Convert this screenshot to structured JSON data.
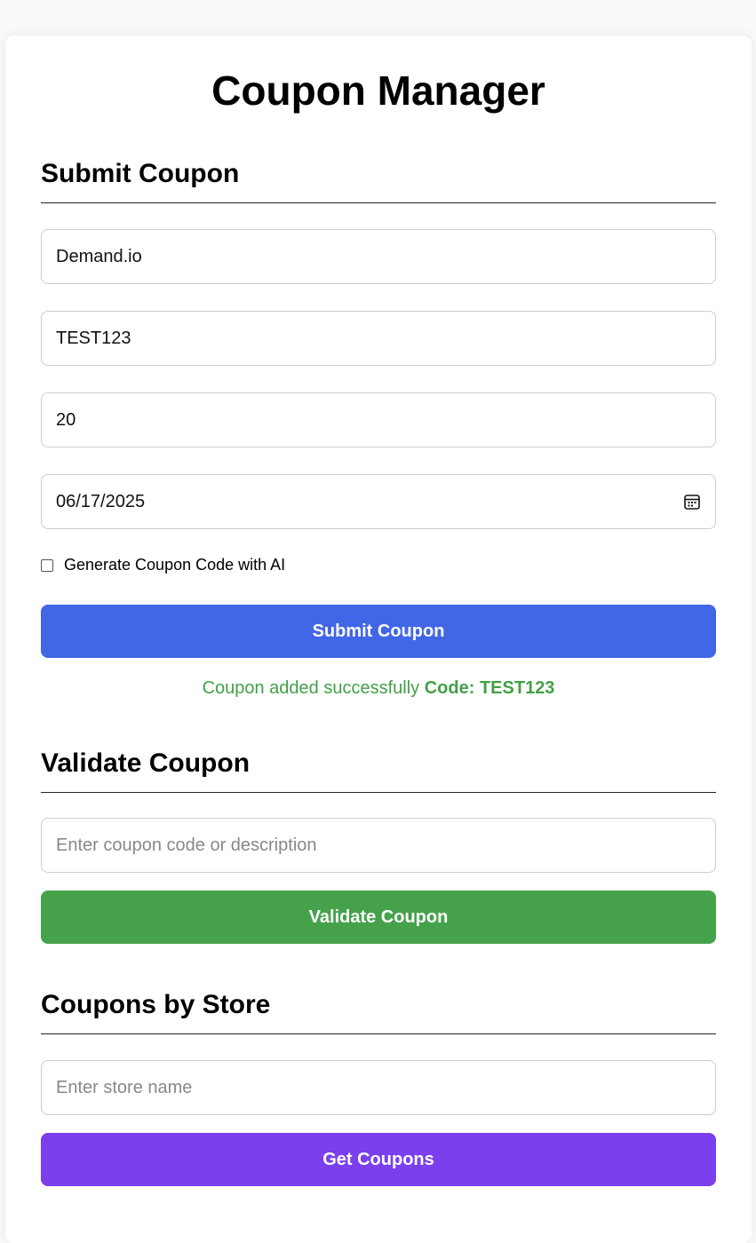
{
  "app": {
    "title": "Coupon Manager"
  },
  "submit_section": {
    "title": "Submit Coupon",
    "store_value": "Demand.io",
    "code_value": "TEST123",
    "discount_value": "20",
    "expiry_value": "06/17/2025",
    "ai_checkbox_label": "Generate Coupon Code with AI",
    "ai_checkbox_checked": false,
    "submit_label": "Submit Coupon",
    "status_message": "Coupon added successfully",
    "status_code": "Code: TEST123"
  },
  "validate_section": {
    "title": "Validate Coupon",
    "input_placeholder": "Enter coupon code or description",
    "button_label": "Validate Coupon"
  },
  "store_section": {
    "title": "Coupons by Store",
    "input_placeholder": "Enter store name",
    "button_label": "Get Coupons"
  },
  "colors": {
    "submit_button": "#4166e6",
    "validate_button": "#45a24b",
    "get_coupons_button": "#7b3fed",
    "success_text": "#43a047"
  },
  "icons": {
    "date_picker": "calendar-icon"
  }
}
